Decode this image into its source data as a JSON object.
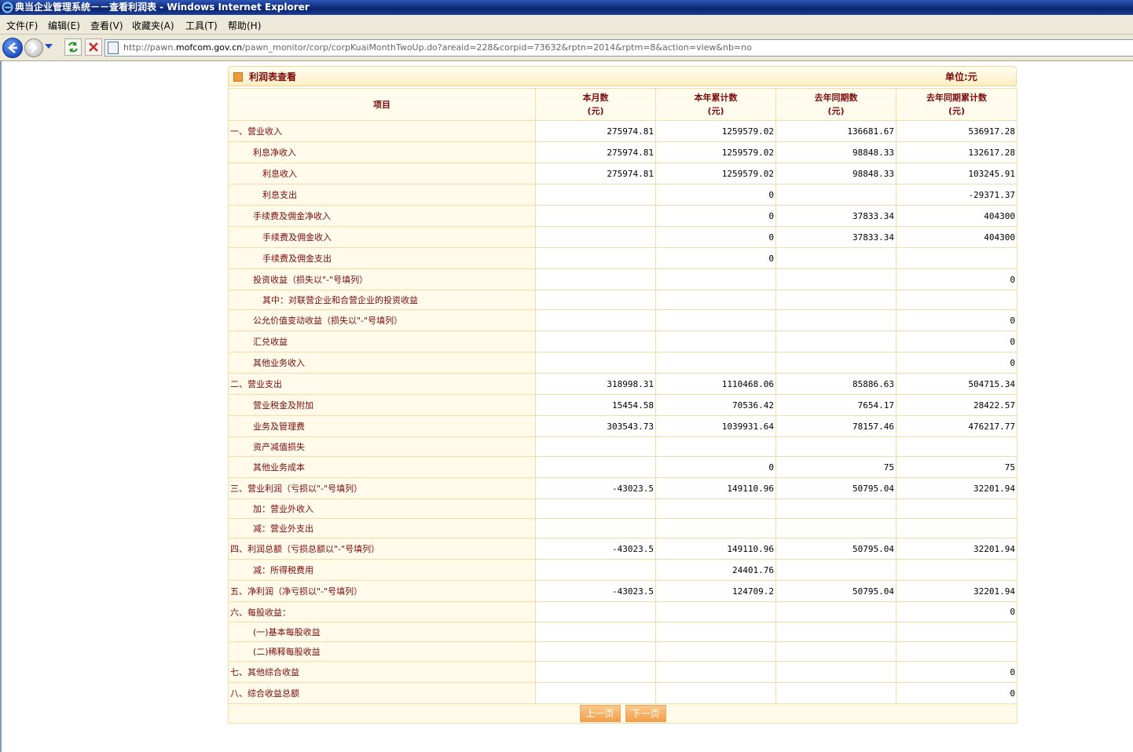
{
  "window": {
    "title": "典当企业管理系统－－查看利润表 - Windows Internet Explorer"
  },
  "menu": [
    "文件(F)",
    "编辑(E)",
    "查看(V)",
    "收藏夹(A)",
    "工具(T)",
    "帮助(H)"
  ],
  "address": {
    "prefix": "http://pawn.",
    "domain": "mofcom.gov.cn",
    "path": "/pawn_monitor/corp/corpKuaiMonthTwoUp.do?areaid=228&corpid=73632&rptn=2014&rptm=8&action=view&nb=no"
  },
  "panel": {
    "title": "利润表查看",
    "unit": "单位:元"
  },
  "headers": [
    {
      "l1": "项目",
      "l2": ""
    },
    {
      "l1": "本月数",
      "l2": "(元)"
    },
    {
      "l1": "本年累计数",
      "l2": "(元)"
    },
    {
      "l1": "去年同期数",
      "l2": "(元)"
    },
    {
      "l1": "去年同期累计数",
      "l2": "(元)"
    }
  ],
  "rows": [
    {
      "name": "一、营业收入",
      "level": 0,
      "v": [
        "275974.81",
        "1259579.02",
        "136681.67",
        "536917.28"
      ]
    },
    {
      "name": "利息净收入",
      "level": 1,
      "v": [
        "275974.81",
        "1259579.02",
        "98848.33",
        "132617.28"
      ]
    },
    {
      "name": "利息收入",
      "level": 2,
      "v": [
        "275974.81",
        "1259579.02",
        "98848.33",
        "103245.91"
      ]
    },
    {
      "name": "利息支出",
      "level": 2,
      "v": [
        "",
        "0",
        "",
        "-29371.37"
      ]
    },
    {
      "name": "手续费及佣金净收入",
      "level": 1,
      "v": [
        "",
        "0",
        "37833.34",
        "404300"
      ]
    },
    {
      "name": "手续费及佣金收入",
      "level": 2,
      "v": [
        "",
        "0",
        "37833.34",
        "404300"
      ]
    },
    {
      "name": "手续费及佣金支出",
      "level": 2,
      "v": [
        "",
        "0",
        "",
        ""
      ]
    },
    {
      "name": "投资收益（损失以\"-\"号填列）",
      "level": 1,
      "v": [
        "",
        "",
        "",
        "0"
      ]
    },
    {
      "name": "其中：对联营企业和合营企业的投资收益",
      "level": 2,
      "v": [
        "",
        "",
        "",
        ""
      ]
    },
    {
      "name": "公允价值变动收益（损失以\"-\"号填列）",
      "level": 1,
      "v": [
        "",
        "",
        "",
        "0"
      ]
    },
    {
      "name": "汇兑收益",
      "level": 1,
      "v": [
        "",
        "",
        "",
        "0"
      ]
    },
    {
      "name": "其他业务收入",
      "level": 1,
      "v": [
        "",
        "",
        "",
        "0"
      ]
    },
    {
      "name": "二、营业支出",
      "level": 0,
      "v": [
        "318998.31",
        "1110468.06",
        "85886.63",
        "504715.34"
      ]
    },
    {
      "name": "营业税金及附加",
      "level": 1,
      "v": [
        "15454.58",
        "70536.42",
        "7654.17",
        "28422.57"
      ]
    },
    {
      "name": "业务及管理费",
      "level": 1,
      "v": [
        "303543.73",
        "1039931.64",
        "78157.46",
        "476217.77"
      ]
    },
    {
      "name": "资产减值损失",
      "level": 1,
      "v": [
        "",
        "",
        "",
        ""
      ]
    },
    {
      "name": "其他业务成本",
      "level": 1,
      "v": [
        "",
        "0",
        "75",
        "75"
      ]
    },
    {
      "name": "三、营业利润（亏损以\"-\"号填列）",
      "level": 0,
      "v": [
        "-43023.5",
        "149110.96",
        "50795.04",
        "32201.94"
      ]
    },
    {
      "name": "加：营业外收入",
      "level": 1,
      "v": [
        "",
        "",
        "",
        ""
      ]
    },
    {
      "name": "减：营业外支出",
      "level": 1,
      "v": [
        "",
        "",
        "",
        ""
      ]
    },
    {
      "name": "四、利润总额（亏损总额以\"-\"号填列）",
      "level": 0,
      "v": [
        "-43023.5",
        "149110.96",
        "50795.04",
        "32201.94"
      ]
    },
    {
      "name": "减：所得税费用",
      "level": 1,
      "v": [
        "",
        "24401.76",
        "",
        ""
      ]
    },
    {
      "name": "五、净利润（净亏损以\"-\"号填列）",
      "level": 0,
      "v": [
        "-43023.5",
        "124709.2",
        "50795.04",
        "32201.94"
      ]
    },
    {
      "name": "六、每股收益：",
      "level": 0,
      "v": [
        "",
        "",
        "",
        "0"
      ]
    },
    {
      "name": "(一)基本每股收益",
      "level": 1,
      "v": [
        "",
        "",
        "",
        ""
      ]
    },
    {
      "name": "(二)稀释每股收益",
      "level": 1,
      "v": [
        "",
        "",
        "",
        ""
      ]
    },
    {
      "name": "七、其他综合收益",
      "level": 0,
      "v": [
        "",
        "",
        "",
        "0"
      ]
    },
    {
      "name": "八、综合收益总额",
      "level": 0,
      "v": [
        "",
        "",
        "",
        "0"
      ]
    }
  ],
  "pager": {
    "prev": "上一页",
    "next": "下一页"
  }
}
